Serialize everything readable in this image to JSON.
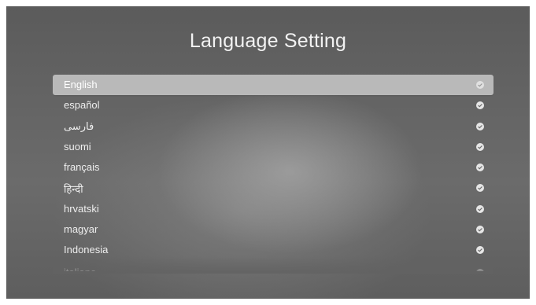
{
  "title": "Language Setting",
  "languages": [
    {
      "label": "English",
      "selected": true
    },
    {
      "label": "español",
      "selected": false
    },
    {
      "label": "فارسی",
      "selected": false
    },
    {
      "label": "suomi",
      "selected": false
    },
    {
      "label": "français",
      "selected": false
    },
    {
      "label": "हिन्दी",
      "selected": false
    },
    {
      "label": "hrvatski",
      "selected": false
    },
    {
      "label": "magyar",
      "selected": false
    },
    {
      "label": "Indonesia",
      "selected": false
    },
    {
      "label": "italiano",
      "selected": false
    }
  ],
  "icons": {
    "row_status": "check-circle-icon"
  },
  "colors": {
    "selected_row": "#b9b9b9",
    "text": "#eeeeee",
    "check": "#e6e6e6"
  }
}
